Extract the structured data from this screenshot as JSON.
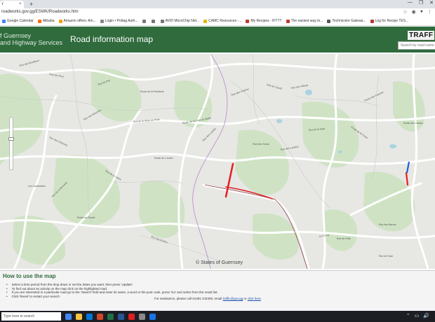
{
  "browser": {
    "tab_title": "r",
    "tab_close": "×",
    "new_tab": "+",
    "window_controls": [
      "—",
      "❐",
      "✕"
    ],
    "url": "roadworks.gov.gg/ESWK/Roadworks.htm",
    "bookmarks": [
      {
        "label": "Google Calendar",
        "color": "#4285f4"
      },
      {
        "label": "Alibaba",
        "color": "#ff6a00"
      },
      {
        "label": "Amazon offers: Am...",
        "color": "#f0a30a"
      },
      {
        "label": "Login • Pottag Auth...",
        "color": "#888888"
      },
      {
        "label": "",
        "color": "#777777"
      },
      {
        "label": "",
        "color": "#777777"
      },
      {
        "label": "AVID MicroChip Net...",
        "color": "#777777"
      },
      {
        "label": "CAMC Resources -...",
        "color": "#e7b400"
      },
      {
        "label": "My Recipes - IFTTT",
        "color": "#c0392b"
      },
      {
        "label": "The easiest way to...",
        "color": "#c0392b"
      },
      {
        "label": "Technicolor Gatewa...",
        "color": "#555555"
      },
      {
        "label": "Log for Recipe TES...",
        "color": "#b03a2e"
      }
    ]
  },
  "header": {
    "org_line1": "f Guernsey",
    "org_line2": "and Highway Services",
    "title": "Road information map",
    "logo": "TRAFF",
    "search_placeholder": "Search by road name"
  },
  "map": {
    "copyright": "© States of Guernsey",
    "road_labels": [
      "Rue des Bouilleurs",
      "Rue des Pres",
      "Rue du Prel",
      "Route de la Palloterie",
      "Rue des Vicheries",
      "Rue des Mourains",
      "Rue de la Haye du Puits",
      "Route de la Croix au Baillif",
      "Rue des Vinaires",
      "Rue du Courtil",
      "Rue des Tilleuls",
      "Route des Frances",
      "Les Cambrettes",
      "Rue de la Lague",
      "Route du Coudre",
      "Rue des Landes",
      "Rue des Grons",
      "Rue des Landeis",
      "Rue de la Gele",
      "Route de la Fosse",
      "Rue de la Bouverie",
      "Route du Ronde",
      "Rue des Brulins",
      "Le Crocq",
      "Rue du Puits",
      "Rue de Haut",
      "Rue des Barras",
      "Route des Camps"
    ],
    "roadwork_color": "#e02020"
  },
  "help": {
    "title": "How to use the map",
    "items": [
      "Select a time period from the drop down or set the dates you want, then press 'Update'.",
      "To find out about an activity on the map click on the highlighted road.",
      "If you are interested in a particular road go to the 'Search' field and enter its name, a word or the post code, press 'Go' and select from the result list.",
      "Click 'Reset' to restart your search."
    ],
    "assist_prefix": "For assistance, please call 01481 243400, email",
    "assist_email": "traffic@gov.gg",
    "assist_mid": "or",
    "assist_link": "click here",
    "assist_suffix": "."
  },
  "taskbar": {
    "search": "Type here to search",
    "apps": [
      "#4285f4",
      "#f6c342",
      "#0078d7",
      "#d24726",
      "#1e7145",
      "#2b579a",
      "#e02020",
      "#8a8a8a",
      "#1a73e8"
    ],
    "tray": [
      "⌃",
      "▭",
      "🔊"
    ]
  }
}
